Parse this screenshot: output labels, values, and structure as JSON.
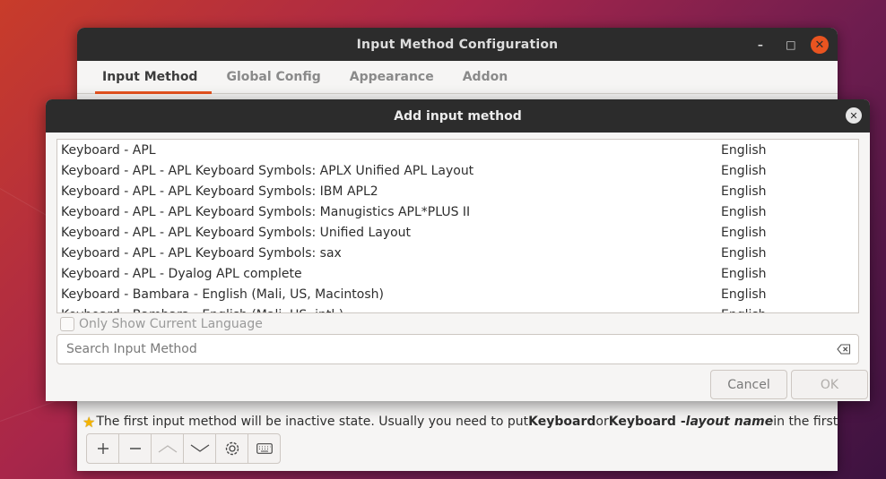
{
  "main_window": {
    "title": "Input Method Configuration",
    "tabs": [
      "Input Method",
      "Global Config",
      "Appearance",
      "Addon"
    ],
    "hint": {
      "part1": "The first input method will be inactive state. Usually you need to put ",
      "bold1": "Keyboard",
      "part2": " or ",
      "bold2": "Keyboard - ",
      "italic": "layout name",
      "part3": " in the first place."
    },
    "toolbar_icons": [
      "add-icon",
      "remove-icon",
      "move-up-icon",
      "move-down-icon",
      "configure-icon",
      "keyboard-icon"
    ],
    "wm_buttons": {
      "minimize": "–",
      "maximize": "□",
      "close": "✕"
    }
  },
  "dialog": {
    "title": "Add input method",
    "rows": [
      {
        "name": "Keyboard - APL",
        "lang": "English"
      },
      {
        "name": "Keyboard - APL - APL Keyboard Symbols: APLX Unified APL Layout",
        "lang": "English"
      },
      {
        "name": "Keyboard - APL - APL Keyboard Symbols: IBM APL2",
        "lang": "English"
      },
      {
        "name": "Keyboard - APL - APL Keyboard Symbols: Manugistics APL*PLUS II",
        "lang": "English"
      },
      {
        "name": "Keyboard - APL - APL Keyboard Symbols: Unified Layout",
        "lang": "English"
      },
      {
        "name": "Keyboard - APL - APL Keyboard Symbols: sax",
        "lang": "English"
      },
      {
        "name": "Keyboard - APL - Dyalog APL complete",
        "lang": "English"
      },
      {
        "name": "Keyboard - Bambara - English (Mali, US, Macintosh)",
        "lang": "English"
      },
      {
        "name": "Keyboard - Bambara - English (Mali, US, intl.)",
        "lang": "English"
      }
    ],
    "only_current_language": "Only Show Current Language",
    "search_placeholder": "Search Input Method",
    "cancel": "Cancel",
    "ok": "OK"
  },
  "colors": {
    "accent": "#e95420",
    "titlebar": "#2c2c2c"
  }
}
